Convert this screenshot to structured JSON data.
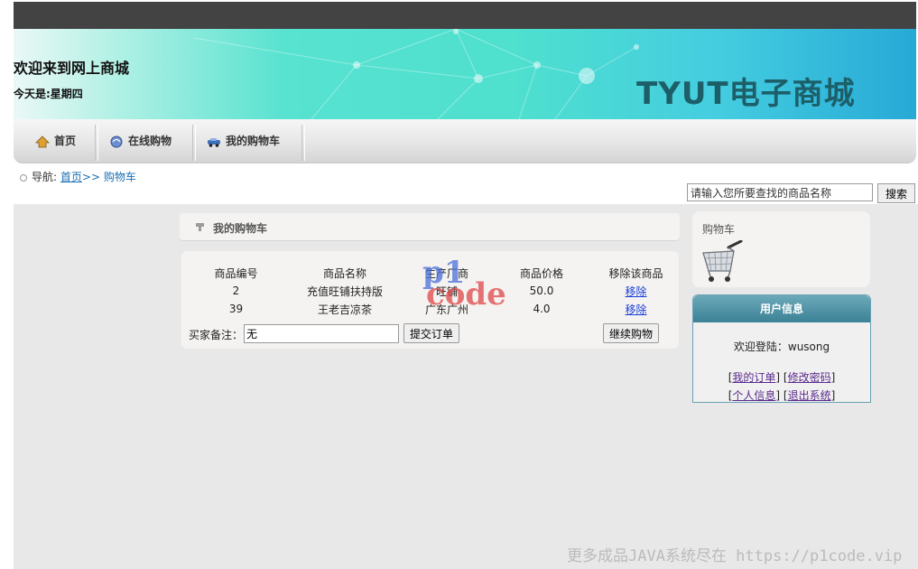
{
  "header": {
    "welcome": "欢迎来到网上商城",
    "today": "今天是:星期四",
    "brand": "TYUT电子商城"
  },
  "nav": {
    "items": [
      {
        "label": "首页",
        "icon": "home-icon"
      },
      {
        "label": "在线购物",
        "icon": "shopping-icon"
      },
      {
        "label": "我的购物车",
        "icon": "car-icon"
      }
    ]
  },
  "breadcrumb": {
    "prefix": "导航:",
    "home": "首页",
    "sep": ">>",
    "current": "购物车"
  },
  "search": {
    "value": "请输入您所要查找的商品名称",
    "button": "搜索"
  },
  "cart": {
    "title": "我的购物车",
    "columns": [
      "商品编号",
      "商品名称",
      "生产厂商",
      "商品价格",
      "移除该商品"
    ],
    "rows": [
      {
        "id": "2",
        "name": "充值旺铺扶持版",
        "maker": "旺铺",
        "price": "50.0",
        "action": "移除"
      },
      {
        "id": "39",
        "name": "王老吉凉茶",
        "maker": "广东广州",
        "price": "4.0",
        "action": "移除"
      }
    ],
    "note_label": "买家备注：",
    "note_value": "无",
    "submit": "提交订单",
    "continue": "继续购物"
  },
  "side_cart": {
    "title": "购物车"
  },
  "user": {
    "title": "用户信息",
    "welcome": "欢迎登陆：wusong",
    "links": [
      "我的订单",
      "修改密码",
      "个人信息",
      "退出系统"
    ]
  },
  "watermark": {
    "logo_top": "p1",
    "logo_bottom": "code",
    "footer": "更多成品JAVA系统尽在 https://p1code.vip"
  },
  "colors": {
    "topbar": "#434343",
    "brand": "#1d5f69",
    "link": "#1a6fb3",
    "user_header": "#4a8ea2"
  }
}
